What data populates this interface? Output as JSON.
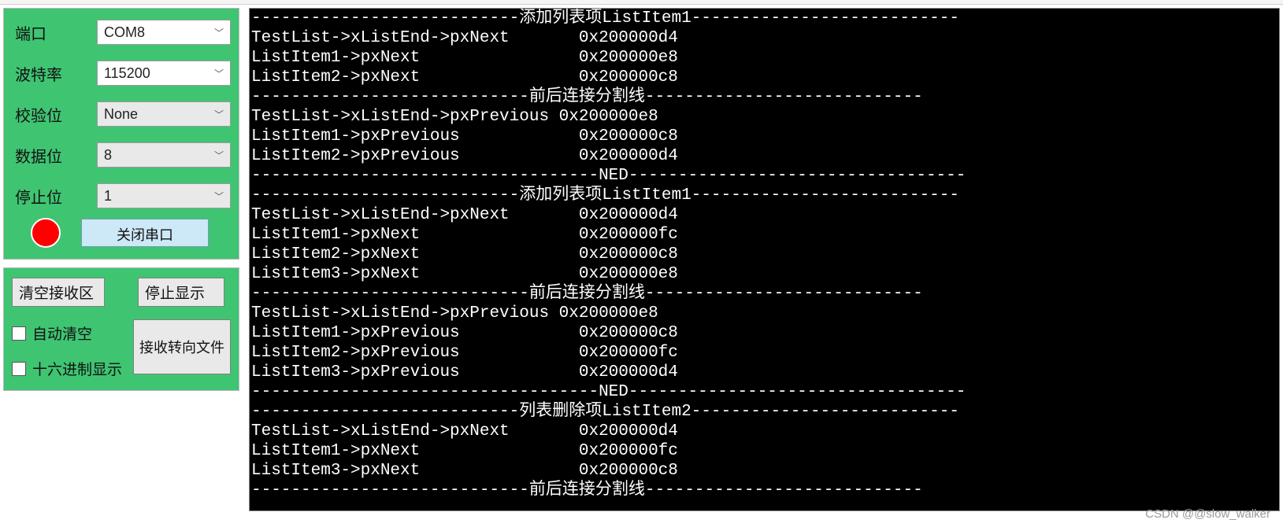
{
  "settings": {
    "port_label": "端口",
    "port_value": "COM8",
    "baud_label": "波特率",
    "baud_value": "115200",
    "parity_label": "校验位",
    "parity_value": "None",
    "data_label": "数据位",
    "data_value": "8",
    "stop_label": "停止位",
    "stop_value": "1",
    "close_btn": "关闭串口",
    "led_color": "#ff0000"
  },
  "recv_panel": {
    "clear_btn": "清空接收区",
    "stop_btn": "停止显示",
    "auto_clear": "自动清空",
    "hex_display": "十六进制显示",
    "to_file_btn": "接收转向文件"
  },
  "terminal_lines": [
    "---------------------------添加列表项ListItem1---------------------------",
    "TestList->xListEnd->pxNext       0x200000d4",
    "ListItem1->pxNext                0x200000e8",
    "ListItem2->pxNext                0x200000c8",
    "----------------------------前后连接分割线----------------------------",
    "TestList->xListEnd->pxPrevious 0x200000e8",
    "ListItem1->pxPrevious            0x200000c8",
    "ListItem2->pxPrevious            0x200000d4",
    "-----------------------------------NED----------------------------------",
    "---------------------------添加列表项ListItem1---------------------------",
    "TestList->xListEnd->pxNext       0x200000d4",
    "ListItem1->pxNext                0x200000fc",
    "ListItem2->pxNext                0x200000c8",
    "ListItem3->pxNext                0x200000e8",
    "----------------------------前后连接分割线----------------------------",
    "TestList->xListEnd->pxPrevious 0x200000e8",
    "ListItem1->pxPrevious            0x200000c8",
    "ListItem2->pxPrevious            0x200000fc",
    "ListItem3->pxPrevious            0x200000d4",
    "-----------------------------------NED----------------------------------",
    "---------------------------列表删除项ListItem2---------------------------",
    "TestList->xListEnd->pxNext       0x200000d4",
    "ListItem1->pxNext                0x200000fc",
    "ListItem3->pxNext                0x200000c8",
    "----------------------------前后连接分割线----------------------------"
  ],
  "watermark": "CSDN @@slow_walker"
}
